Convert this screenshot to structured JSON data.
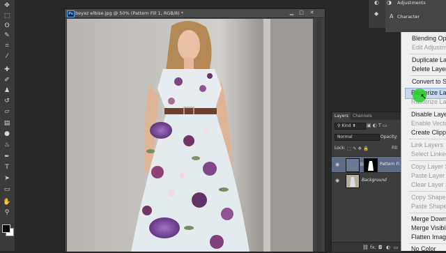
{
  "document": {
    "title": "beyaz elbise.jpg @ 50% (Pattern Fill 1, RGB/8) *",
    "app_badge": "Ps"
  },
  "top_panels": {
    "adjustments": "Adjustments",
    "character": "Character",
    "character_icon": "A"
  },
  "layers_panel": {
    "tabs": [
      "Layers",
      "Channels"
    ],
    "kind_label": "Kind",
    "blend_mode": "Normal",
    "opacity_label": "Opacity:",
    "lock_label": "Lock:",
    "fill_label": "Fill",
    "layers": [
      {
        "name": "Pattern Fi",
        "selected": true
      },
      {
        "name": "Background",
        "selected": false
      }
    ],
    "footer_icons": [
      "link-icon",
      "fx-icon",
      "mask-icon",
      "adjustment-icon",
      "folder-icon",
      "new-layer-icon",
      "trash-icon"
    ],
    "fx_text": "fx."
  },
  "context_menu": {
    "items": [
      {
        "label": "Blending Op",
        "enabled": true
      },
      {
        "label": "Edit Adjustm",
        "enabled": false
      },
      {
        "label": "Duplicate La",
        "enabled": true
      },
      {
        "label": "Delete Layer",
        "enabled": true
      },
      {
        "label": "Convert to S",
        "enabled": true
      },
      {
        "label": "Rasterize Lay",
        "enabled": true,
        "highlighted": true
      },
      {
        "label": "Rasterize Lay",
        "enabled": false
      },
      {
        "label": "Disable Laye",
        "enabled": true
      },
      {
        "label": "Enable Vecto",
        "enabled": false
      },
      {
        "label": "Create Clipp",
        "enabled": true
      },
      {
        "label": "Link Layers",
        "enabled": false
      },
      {
        "label": "Select Linked",
        "enabled": false
      },
      {
        "label": "Copy Layer S",
        "enabled": false
      },
      {
        "label": "Paste Layer S",
        "enabled": false
      },
      {
        "label": "Clear Layer S",
        "enabled": false
      },
      {
        "label": "Copy Shape",
        "enabled": false
      },
      {
        "label": "Paste Shape",
        "enabled": false
      },
      {
        "label": "Merge Down",
        "enabled": true
      },
      {
        "label": "Merge Visibl",
        "enabled": true
      },
      {
        "label": "Flatten Imag",
        "enabled": true
      },
      {
        "label": "No Color",
        "enabled": true
      }
    ]
  },
  "colors": {
    "ui_dark": "#262626",
    "panel": "#3d3d3d",
    "selection": "#5d6b84",
    "menu_bg": "#f0f0f0",
    "menu_highlight": "#c8d8ee",
    "cursor_highlight": "#28d228"
  }
}
